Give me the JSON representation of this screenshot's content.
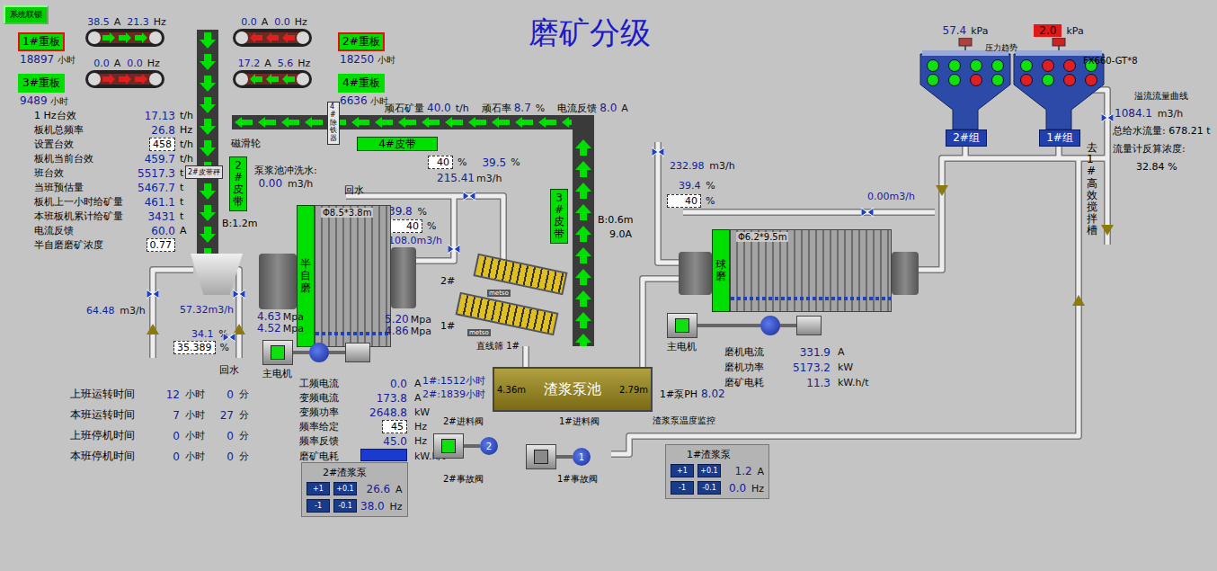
{
  "header": {
    "interlock": "系统联锁",
    "title": "磨矿分级"
  },
  "feeders": [
    {
      "name": "1#重板",
      "hours": "18897",
      "hours_unit": "小时",
      "current": "38.5",
      "current_unit": "A",
      "freq": "21.3",
      "freq_unit": "Hz",
      "running": true,
      "alarm": true
    },
    {
      "name": "2#重板",
      "hours": "18250",
      "hours_unit": "小时",
      "current": "0.0",
      "current_unit": "A",
      "freq": "0.0",
      "freq_unit": "Hz",
      "running": false,
      "alarm": true
    },
    {
      "name": "3#重板",
      "hours": "9489",
      "hours_unit": "小时",
      "current": "0.0",
      "current_unit": "A",
      "freq": "0.0",
      "freq_unit": "Hz",
      "running": false,
      "alarm": false
    },
    {
      "name": "4#重板",
      "hours": "6636",
      "hours_unit": "小时",
      "current": "17.2",
      "current_unit": "A",
      "freq": "5.6",
      "freq_unit": "Hz",
      "running": true,
      "alarm": false
    }
  ],
  "stats": [
    {
      "label": "1 Hz台效",
      "value": "17.13",
      "unit": "t/h",
      "kind": "reading"
    },
    {
      "label": "板机总频率",
      "value": "26.8",
      "unit": "Hz",
      "kind": "reading"
    },
    {
      "label": "设置台效",
      "value": "458",
      "unit": "t/h",
      "kind": "input"
    },
    {
      "label": "板机当前台效",
      "value": "459.7",
      "unit": "t/h",
      "kind": "reading"
    },
    {
      "label": "班台效",
      "value": "5517.3",
      "unit": "t",
      "kind": "reading"
    },
    {
      "label": "当班预估量",
      "value": "5467.7",
      "unit": "t",
      "kind": "reading"
    },
    {
      "label": "板机上一小时给矿量",
      "value": "461.1",
      "unit": "t",
      "kind": "reading"
    },
    {
      "label": "本班板机累计给矿量",
      "value": "3431",
      "unit": "t",
      "kind": "reading"
    },
    {
      "label": "电流反馈",
      "value": "60.0",
      "unit": "A",
      "kind": "reading"
    },
    {
      "label": "半自磨磨矿浓度",
      "value": "0.77",
      "kind": "input"
    }
  ],
  "run_times": [
    {
      "label": "上班运转时间",
      "hours": "12",
      "hours_unit": "小时",
      "minutes": "0",
      "minutes_unit": "分"
    },
    {
      "label": "本班运转时间",
      "hours": "7",
      "hours_unit": "小时",
      "minutes": "27",
      "minutes_unit": "分"
    },
    {
      "label": "上班停机时间",
      "hours": "0",
      "hours_unit": "小时",
      "minutes": "0",
      "minutes_unit": "分"
    },
    {
      "label": "本班停机时间",
      "hours": "0",
      "hours_unit": "小时",
      "minutes": "0",
      "minutes_unit": "分"
    }
  ],
  "conveyors": {
    "belt4": {
      "label": "4#皮带",
      "magnet": "磁滑轮",
      "iron_remover": "4#除铁器",
      "readings": [
        {
          "label": "顽石矿量",
          "value": "40.0",
          "unit": "t/h"
        },
        {
          "label": "顽石率",
          "value": "8.7",
          "unit": "%"
        },
        {
          "label": "电流反馈",
          "value": "8.0",
          "unit": "A"
        }
      ]
    },
    "belt2": {
      "label": "2#皮带",
      "scale": "2#皮带秤",
      "width": "B:1.2m"
    },
    "belt3": {
      "label": "3#皮带",
      "width": "B:0.6m",
      "current": "9.0A"
    }
  },
  "feed": {
    "water_left": "64.48",
    "water_left_unit": "m3/h",
    "water_right": "57.32m3/h",
    "density": "34.1",
    "density_unit": "%",
    "setpoint": "35.389",
    "setpoint_unit": "%",
    "return_water": "回水"
  },
  "flush": {
    "label": "泵浆池冲洗水:",
    "value": "0.00",
    "unit": "m3/h",
    "return_water": "回水"
  },
  "screen_water": {
    "setpoint": "40",
    "setpoint_unit": "%",
    "opening": "39.5",
    "opening_unit": "%",
    "flow": "215.41",
    "flow_unit": "m3/h"
  },
  "sag_water": {
    "opening": "39.8",
    "opening_unit": "%",
    "setpoint": "40",
    "setpoint_unit": "%",
    "flow": "108.0m3/h"
  },
  "sag": {
    "label": "半自磨",
    "size": "Φ8.5*3.8m",
    "motor": "主电机",
    "motor_running": true,
    "pressure_left": [
      {
        "value": "4.63",
        "unit": "Mpa"
      },
      {
        "value": "4.52",
        "unit": "Mpa"
      }
    ],
    "pressure_right": [
      {
        "value": "5.20",
        "unit": "Mpa"
      },
      {
        "value": "4.86",
        "unit": "Mpa"
      }
    ],
    "data": [
      {
        "label": "工频电流",
        "value": "0.0",
        "unit": "A",
        "kind": "reading"
      },
      {
        "label": "变频电流",
        "value": "173.8",
        "unit": "A",
        "kind": "reading"
      },
      {
        "label": "变频功率",
        "value": "2648.8",
        "unit": "kW",
        "kind": "reading"
      },
      {
        "label": "频率给定",
        "value": "45",
        "unit": "Hz",
        "kind": "input"
      },
      {
        "label": "频率反馈",
        "value": "45.0",
        "unit": "Hz",
        "kind": "reading"
      },
      {
        "label": "磨矿电耗",
        "unit": "kW.h/t",
        "kind": "bar"
      }
    ]
  },
  "screens": {
    "label": "直线筛 1#",
    "brand": "metso",
    "top_no": "2#",
    "bottom_no": "1#"
  },
  "sump": {
    "label": "渣浆泵池",
    "level_left": "4.36m",
    "level_right": "2.79m",
    "hours": [
      "1#:1512小时",
      "2#:1839小时"
    ],
    "ph_label": "1#泵PH",
    "ph": "8.02",
    "temp": "渣浆泵温度监控"
  },
  "valves": {
    "feed2": "2#进料阀",
    "feed1": "1#进料阀",
    "emerg2": "2#事故阀",
    "emerg1": "1#事故阀"
  },
  "pumps": [
    {
      "name": "2#渣浆泵",
      "number": "2",
      "buttons": [
        "+1",
        "+0.1",
        "-1",
        "-0.1"
      ],
      "current": "26.6",
      "current_unit": "A",
      "freq": "38.0",
      "freq_unit": "Hz",
      "running": true
    },
    {
      "name": "1#渣浆泵",
      "number": "1",
      "buttons": [
        "+1",
        "+0.1",
        "-1",
        "-0.1"
      ],
      "current": "1.2",
      "current_unit": "A",
      "freq": "0.0",
      "freq_unit": "Hz",
      "running": false
    }
  ],
  "ball_mill": {
    "label": "球磨",
    "size": "Φ6.2*9.5m",
    "feed_water": "232.98",
    "feed_water_unit": "m3/h",
    "opening": "39.4",
    "opening_unit": "%",
    "setpoint": "40",
    "setpoint_unit": "%",
    "discharge_water": "0.00m3/h",
    "motor": "主电机",
    "motor_running": true,
    "data": [
      {
        "label": "磨机电流",
        "value": "331.9",
        "unit": "A"
      },
      {
        "label": "磨机功率",
        "value": "5173.2",
        "unit": "kW"
      },
      {
        "label": "磨矿电耗",
        "value": "11.3",
        "unit": "kW.h/t"
      }
    ]
  },
  "cyclones": {
    "model": "FX660-GT*8",
    "trend": "压力趋势",
    "groups": [
      {
        "name": "2#组",
        "pressure": "57.4",
        "unit": "kPa",
        "alarm": false,
        "lamps": [
          true,
          true,
          true,
          true,
          true,
          true,
          false,
          true
        ]
      },
      {
        "name": "1#组",
        "pressure": "2.0",
        "unit": "kPa",
        "alarm": true,
        "lamps": [
          true,
          false,
          false,
          true,
          false,
          true,
          false,
          false
        ]
      }
    ]
  },
  "overflow": {
    "curve": "溢流流量曲线",
    "flow": "1084.1",
    "flow_unit": "m3/h",
    "total_label": "总给水流量:",
    "total": "678.21",
    "total_unit": "t",
    "density_label": "流量计反算浓度:",
    "density": "32.84",
    "density_unit": "%",
    "destination": "去1#高效搅拌槽"
  }
}
